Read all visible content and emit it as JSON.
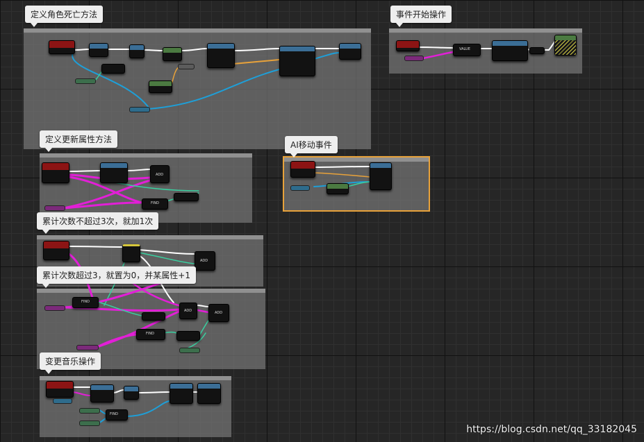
{
  "comments": [
    {
      "id": "death",
      "label": "定义角色死亡方法"
    },
    {
      "id": "begin",
      "label": "事件开始操作"
    },
    {
      "id": "update",
      "label": "定义更新属性方法"
    },
    {
      "id": "ai",
      "label": "AI移动事件"
    },
    {
      "id": "count3",
      "label": "累计次数不超过3次，就加1次"
    },
    {
      "id": "reset",
      "label": "累计次数超过3，就置为0，并某属性+1"
    },
    {
      "id": "music",
      "label": "变更音乐操作"
    }
  ],
  "nodes": {
    "add": "ADD",
    "find": "FIND",
    "value": "VALUE"
  },
  "watermark": "https://blog.csdn.net/qq_33182045",
  "colors": {
    "exec": "#ffffff",
    "object": "#1e9fd8",
    "string": "#e21fd7",
    "float": "#39d0a0",
    "bool": "#e8a23a",
    "struct": "#e8a23a"
  }
}
